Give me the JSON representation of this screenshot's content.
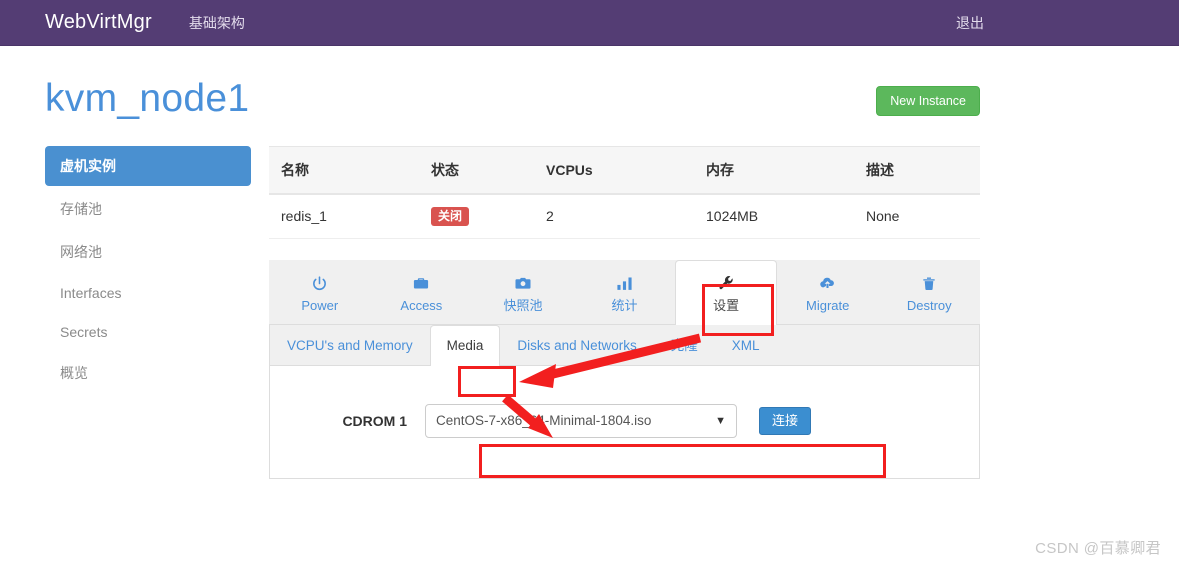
{
  "navbar": {
    "brand": "WebVirtMgr",
    "infrastructure_label": "基础架构",
    "logout_label": "退出",
    "background_color": "#543d74"
  },
  "page": {
    "title": "kvm_node1",
    "title_color": "#4a90d9",
    "new_instance_label": "New Instance",
    "new_instance_color": "#5cb85c"
  },
  "sidebar": {
    "items": [
      {
        "label": "虚机实例",
        "active": true
      },
      {
        "label": "存储池",
        "active": false
      },
      {
        "label": "网络池",
        "active": false
      },
      {
        "label": "Interfaces",
        "active": false
      },
      {
        "label": "Secrets",
        "active": false
      },
      {
        "label": "概览",
        "active": false
      }
    ],
    "active_color": "#4a90d0"
  },
  "instances_table": {
    "columns": [
      "名称",
      "状态",
      "VCPUs",
      "内存",
      "描述"
    ],
    "rows": [
      {
        "name": "redis_1",
        "state": "关闭",
        "state_color": "#d9534f",
        "vcpus": "2",
        "memory": "1024MB",
        "description": "None"
      }
    ]
  },
  "tabs": [
    {
      "label": "Power",
      "icon": "power-icon",
      "active": false
    },
    {
      "label": "Access",
      "icon": "briefcase-icon",
      "active": false
    },
    {
      "label": "快照池",
      "icon": "camera-icon",
      "active": false
    },
    {
      "label": "统计",
      "icon": "bar-chart-icon",
      "active": false
    },
    {
      "label": "设置",
      "icon": "wrench-icon",
      "active": true
    },
    {
      "label": "Migrate",
      "icon": "cloud-upload-icon",
      "active": false
    },
    {
      "label": "Destroy",
      "icon": "trash-icon",
      "active": false
    }
  ],
  "subtabs": [
    {
      "label": "VCPU's and Memory",
      "active": false
    },
    {
      "label": "Media",
      "active": true
    },
    {
      "label": "Disks and Networks",
      "active": false
    },
    {
      "label": "克隆",
      "active": false
    },
    {
      "label": "XML",
      "active": false
    }
  ],
  "media_form": {
    "cdrom_label": "CDROM 1",
    "selected_iso": "CentOS-7-x86_64-Minimal-1804.iso",
    "iso_options": [
      "CentOS-7-x86_64-Minimal-1804.iso"
    ],
    "connect_label": "连接",
    "connect_color": "#3b8ed0"
  },
  "annotations": {
    "highlight_color": "#f21f1f",
    "boxes": [
      "设置",
      "Media",
      "CDROM 1 选择器"
    ],
    "arrows": 2
  },
  "watermark": {
    "text": "CSDN @百慕卿君"
  }
}
